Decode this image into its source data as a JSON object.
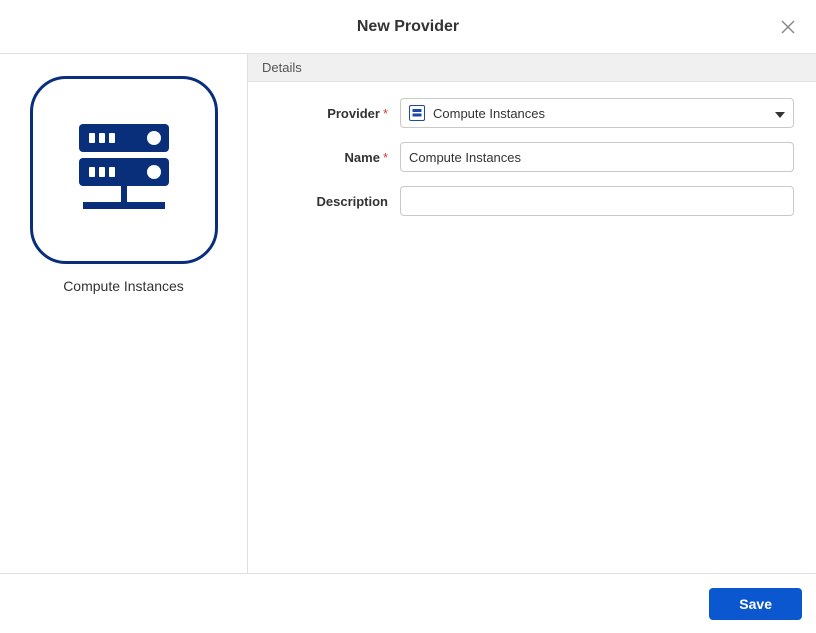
{
  "dialog": {
    "title": "New Provider"
  },
  "left": {
    "provider_caption": "Compute Instances"
  },
  "details": {
    "section_title": "Details",
    "provider_label": "Provider",
    "provider_value": "Compute Instances",
    "name_label": "Name",
    "name_value": "Compute Instances",
    "description_label": "Description",
    "description_value": ""
  },
  "footer": {
    "save_label": "Save"
  },
  "required_marker": "*"
}
